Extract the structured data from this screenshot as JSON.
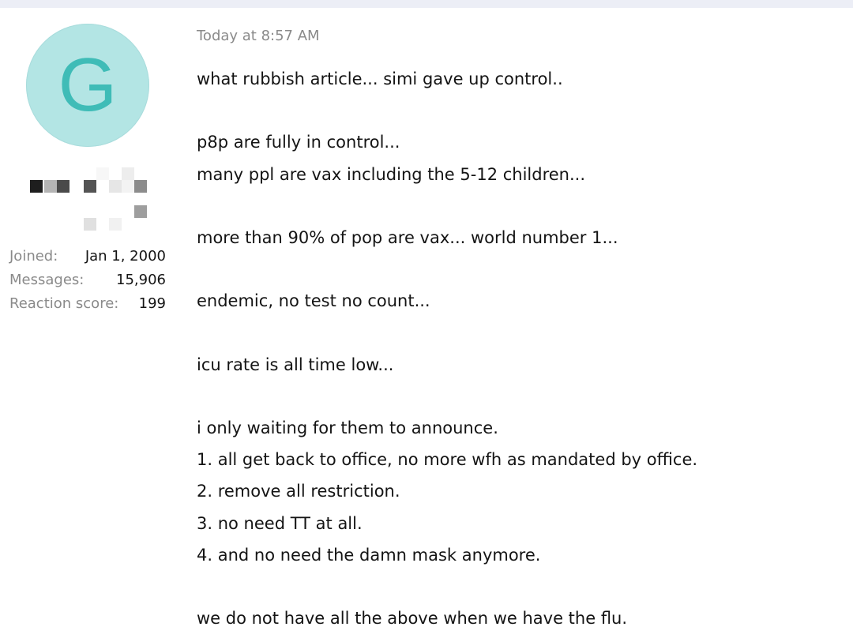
{
  "post": {
    "timestamp": "Today at 8:57 AM",
    "body_lines": [
      "what rubbish article... simi gave up control..",
      "",
      "p8p are fully in control...",
      "many ppl are vax including the 5-12 children...",
      "",
      "more than 90% of pop are vax... world number 1...",
      "",
      "endemic, no test no count...",
      "",
      "icu rate is all time low...",
      "",
      "i only waiting for them to announce.",
      "1. all get back to office, no more wfh as mandated by office.",
      "2. remove all restriction.",
      "3. no need TT at all.",
      "4. and no need the damn mask anymore.",
      "",
      "we do not have all the above when we have the flu."
    ]
  },
  "author": {
    "avatar_letter": "G",
    "stats": [
      {
        "label": "Joined:",
        "value": "Jan 1, 2000"
      },
      {
        "label": "Messages:",
        "value": "15,906"
      },
      {
        "label": "Reaction score:",
        "value": "199"
      }
    ]
  },
  "colors": {
    "avatar_bg": "#b3e5e4",
    "avatar_letter": "#3fbcb7",
    "muted_text": "#8a8a8a",
    "body_text": "#141414"
  }
}
